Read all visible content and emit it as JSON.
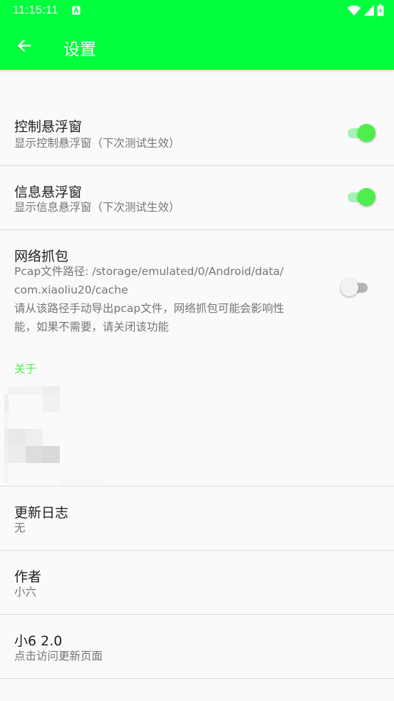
{
  "status_bar": {
    "time": "11:15:11",
    "icons": [
      "a-notification-icon",
      "wifi-icon",
      "signal-icon",
      "battery-icon"
    ]
  },
  "app_bar": {
    "title": "设置",
    "back_icon": "arrow-left-icon"
  },
  "colors": {
    "primary": "#00ff3c",
    "accent": "#4cef4c",
    "switch_track_on": "#a6f2b1",
    "switch_track_off": "#b5b5b5",
    "switch_thumb_off": "#f3f3f3",
    "text_primary": "#212121",
    "text_secondary": "#757575"
  },
  "preferences": {
    "control_float": {
      "title": "控制悬浮窗",
      "summary": "显示控制悬浮窗（下次测试生效）",
      "enabled": true
    },
    "info_float": {
      "title": "信息悬浮窗",
      "summary": "显示信息悬浮窗（下次测试生效）",
      "enabled": true
    },
    "packet_capture": {
      "title": "网络抓包",
      "summary": "Pcap文件路径: /storage/emulated/0/Android/data/\ncom.xiaoliu20/cache\n请从该路径手动导出pcap文件，网络抓包可能会影响性\n能，如果不需要，请关闭该功能",
      "enabled": false
    }
  },
  "about": {
    "category": "关于",
    "changelog": {
      "title": "更新日志",
      "summary": "无"
    },
    "author": {
      "title": "作者",
      "summary": "小六"
    },
    "version": {
      "title": "小6 2.0",
      "summary": "点击访问更新页面"
    }
  }
}
